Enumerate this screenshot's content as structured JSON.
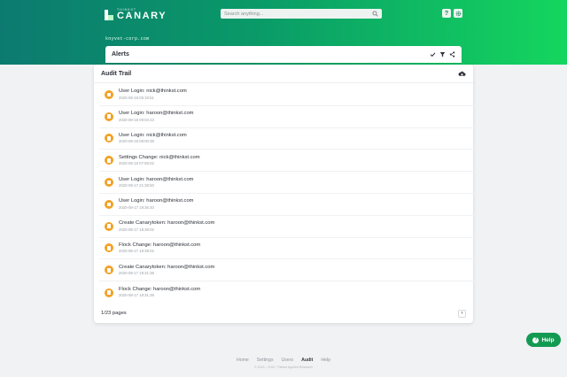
{
  "header": {
    "brand_small": "THINKST",
    "brand_name": "CANARY",
    "search_placeholder": "Search anything...",
    "help_icon": "question-icon",
    "settings_icon": "gear-icon",
    "flock_name": "knyvet-corp.com"
  },
  "alerts_bar": {
    "title": "Alerts",
    "actions": [
      "check-icon",
      "filter-icon",
      "share-icon"
    ]
  },
  "audit": {
    "title": "Audit Trail",
    "download_icon": "cloud-download-icon",
    "entries": [
      {
        "title": "User Login: nick@thinkst.com",
        "date": "2020-08-18 05:19:51"
      },
      {
        "title": "User Login: haroon@thinkst.com",
        "date": "2020-08-18 09:02:23"
      },
      {
        "title": "User Login: nick@thinkst.com",
        "date": "2020-08-18 08:00:38"
      },
      {
        "title": "Settings Change: nick@thinkst.com",
        "date": "2020-08-18 07:59:02"
      },
      {
        "title": "User Login: haroon@thinkst.com",
        "date": "2020-08-17 21:38:50"
      },
      {
        "title": "User Login: haroon@thinkst.com",
        "date": "2020-08-17 19:36:40"
      },
      {
        "title": "Create Canarytoken: haroon@thinkst.com",
        "date": "2020-08-17 18:38:02"
      },
      {
        "title": "Flock Change: haroon@thinkst.com",
        "date": "2020-08-17 18:38:02"
      },
      {
        "title": "Create Canarytoken: haroon@thinkst.com",
        "date": "2020-08-17 18:31:38"
      },
      {
        "title": "Flock Change: haroon@thinkst.com",
        "date": "2020-08-17 18:31:38"
      }
    ],
    "pagination": "1/23 pages",
    "next_label": "›"
  },
  "help_button": {
    "label": "Help",
    "icon_glyph": "?"
  },
  "footer": {
    "links": [
      {
        "label": "Home",
        "active": false
      },
      {
        "label": "Settings",
        "active": false
      },
      {
        "label": "Users",
        "active": false
      },
      {
        "label": "Audit",
        "active": true
      },
      {
        "label": "Help",
        "active": false
      }
    ],
    "copyright": "© 2015 – 2020, Thinkst Applied Research"
  },
  "colors": {
    "accent_green": "#14d65e",
    "teal": "#0c7a70",
    "entry_icon": "#f2a126",
    "help_green": "#139a52"
  }
}
